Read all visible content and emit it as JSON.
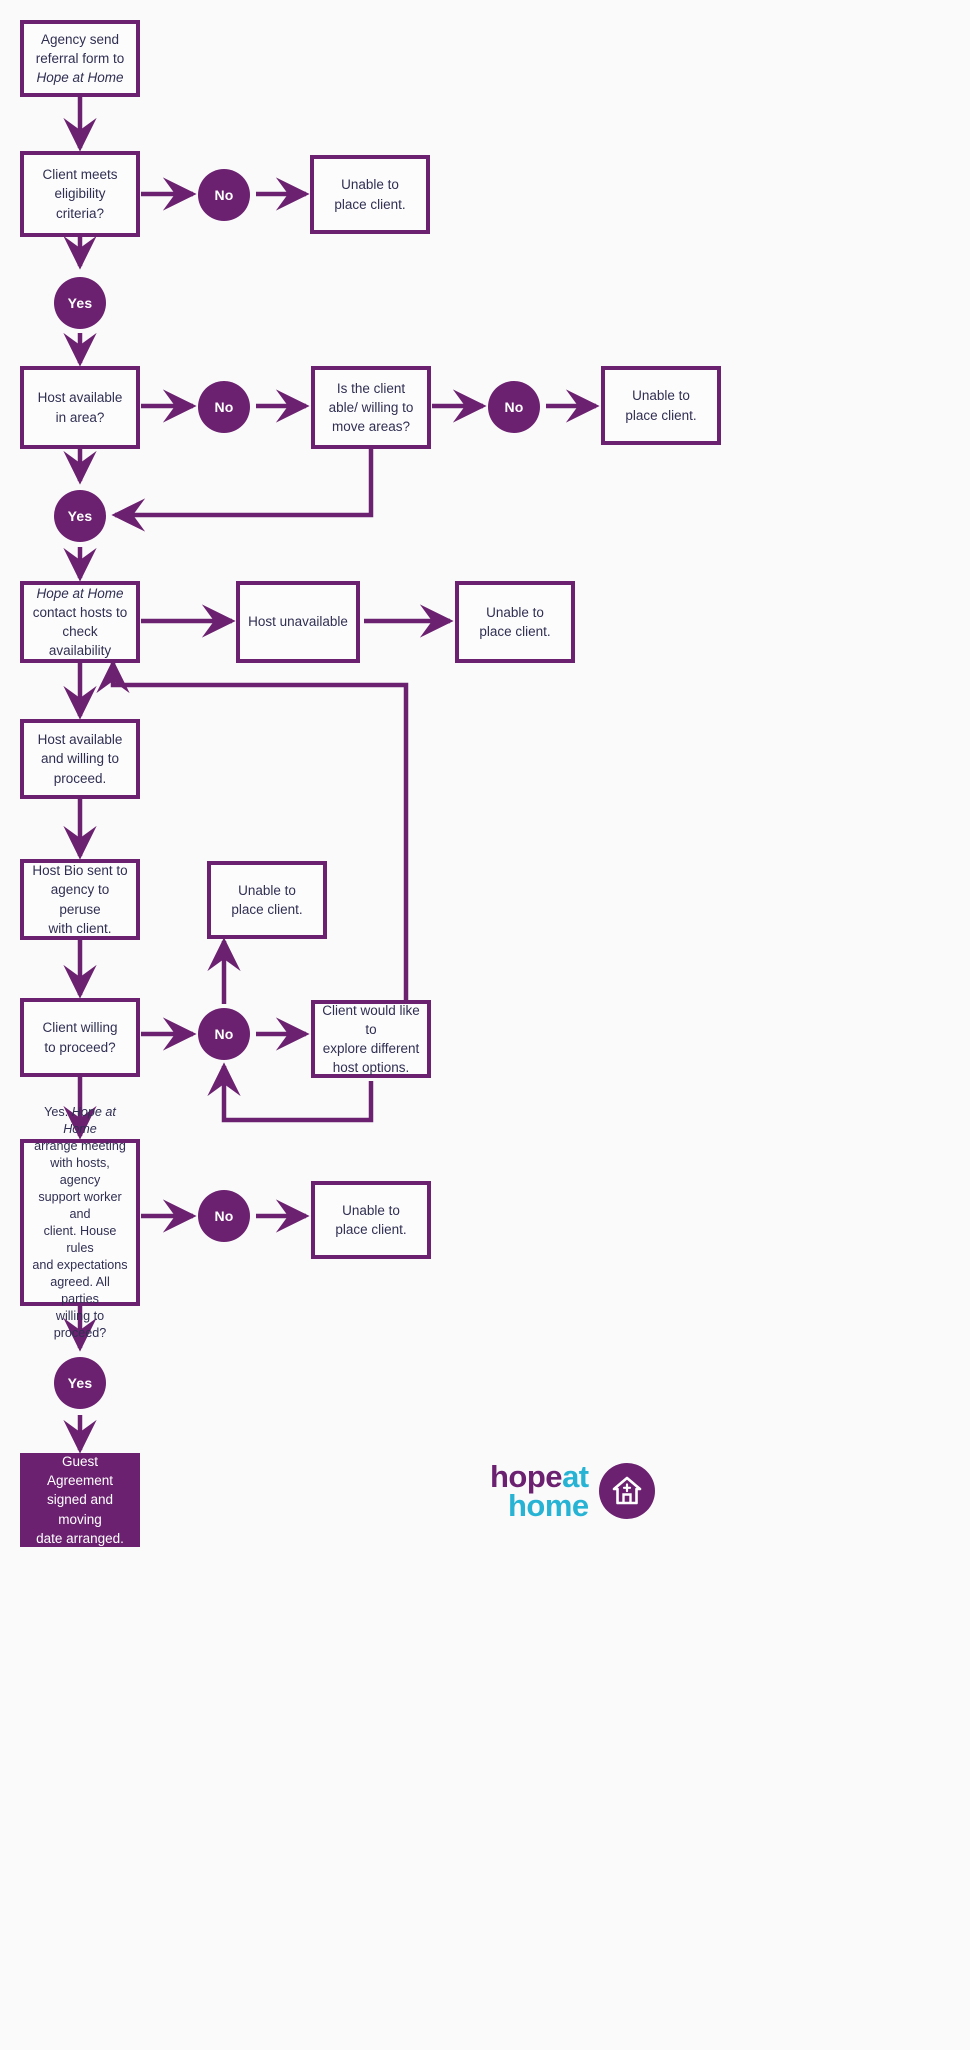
{
  "theme": {
    "purple": "#6b2170",
    "cyan": "#27b4d4",
    "text": "#2f2f52",
    "background": "#fbfafb",
    "box_fill": "#fdfcfd"
  },
  "title": "Hope at Home client referral and placement flowchart",
  "nodes": {
    "agency_referral": {
      "line1": "Agency send",
      "line2": "referral form to",
      "line3": "Hope at Home"
    },
    "eligibility": {
      "line1": "Client meets",
      "line2": "eligibility criteria?"
    },
    "unable_1": {
      "line1": "Unable to",
      "line2": "place client."
    },
    "host_available_area": {
      "line1": "Host available",
      "line2": "in area?"
    },
    "move_areas": {
      "line1": "Is the client",
      "line2": "able/ willing to",
      "line3": "move areas?"
    },
    "unable_2": {
      "line1": "Unable to",
      "line2": "place client."
    },
    "contact_hosts": {
      "line1": "Hope at Home",
      "line2": "contact hosts to",
      "line3": "check availability"
    },
    "host_unavailable": {
      "line1": "Host unavailable"
    },
    "unable_3": {
      "line1": "Unable to",
      "line2": "place client."
    },
    "host_willing": {
      "line1": "Host available",
      "line2": "and willing to",
      "line3": "proceed."
    },
    "host_bio": {
      "line1": "Host Bio sent to",
      "line2": "agency to peruse",
      "line3": "with client."
    },
    "unable_4": {
      "line1": "Unable to",
      "line2": "place client."
    },
    "client_willing": {
      "line1": "Client willing",
      "line2": "to proceed?"
    },
    "explore_other": {
      "line1": "Client would like to",
      "line2": "explore different",
      "line3": "host options."
    },
    "arrange_meeting": {
      "line1": "Yes.",
      "line1_italic": "Hope at Home",
      "line2": "arrange meeting",
      "line3": "with hosts, agency",
      "line4": "support worker and",
      "line5": "client.  House rules",
      "line6": "and expectations",
      "line7": "agreed.  All parties",
      "line8": "willing to proceed?"
    },
    "unable_5": {
      "line1": "Unable to",
      "line2": "place client."
    },
    "guest_agreement": {
      "line1": "Guest Agreement",
      "line2": "signed and moving",
      "line3": "date arranged."
    }
  },
  "decisions": {
    "no_eligibility": "No",
    "yes_eligibility": "Yes",
    "no_host_area": "No",
    "no_move_areas": "No",
    "yes_host_area": "Yes",
    "no_client_willing": "No",
    "no_arrange_meeting": "No",
    "yes_arrange_meeting": "Yes"
  },
  "logo": {
    "hope": "hope",
    "at": "at",
    "home": "home",
    "icon": "house-icon"
  }
}
